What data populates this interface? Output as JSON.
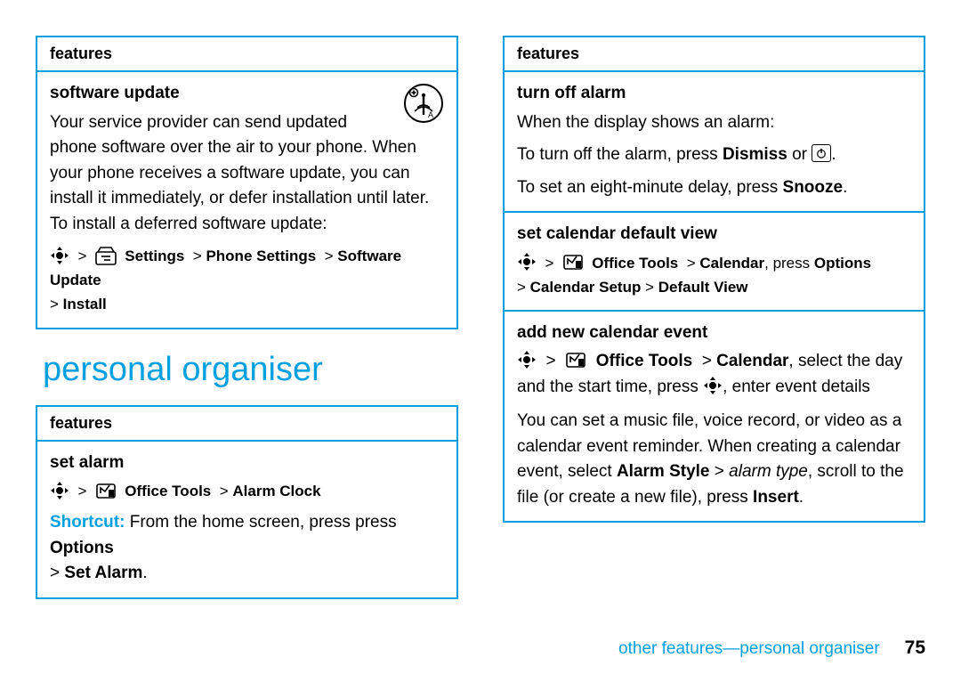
{
  "col1": {
    "box1": {
      "header": "features",
      "section1": {
        "title": "software update",
        "body": "Your service provider can send updated phone software over the air to your phone. When your phone receives a software update, you can install it immediately, or defer installation until later. To install a deferred software update:",
        "path_settings": "Settings",
        "path_phone": "Phone Settings",
        "path_sw": "Software Update",
        "path_install": "Install"
      }
    },
    "heading": "personal organiser",
    "box2": {
      "header": "features",
      "section1": {
        "title": "set alarm",
        "path_office": "Office Tools",
        "path_alarm": "Alarm Clock",
        "shortcut_label": "Shortcut:",
        "shortcut_text": " From the home screen, press press ",
        "shortcut_options": "Options",
        "shortcut_setalarm": "Set Alarm"
      }
    }
  },
  "col2": {
    "box1": {
      "header": "features",
      "s1": {
        "title": "turn off alarm",
        "l1": "When the display shows an alarm:",
        "l2a": "To turn off the alarm, press ",
        "l2b": "Dismiss",
        "l2c": " or ",
        "l3a": "To set an eight-minute delay, press ",
        "l3b": "Snooze"
      },
      "s2": {
        "title": "set calendar default view",
        "path_office": "Office Tools",
        "path_cal": "Calendar",
        "press": ", press ",
        "options": "Options",
        "path_setup": "Calendar Setup",
        "path_default": "Default View"
      },
      "s3": {
        "title": "add new calendar event",
        "path_office": "Office Tools",
        "path_cal": "Calendar",
        "t1": ", select the day and the start time, press ",
        "t2": ", enter event details",
        "p1": "You can set a music file, voice record, or video as a calendar event reminder. When creating a calendar event, select ",
        "alarm_style": "Alarm Style",
        "gt": " > ",
        "alarm_type": "alarm type",
        "p2": ", scroll to the file (or create a new file), press ",
        "insert": "Insert"
      }
    }
  },
  "footer": {
    "text": "other features—personal organiser",
    "page": "75"
  }
}
